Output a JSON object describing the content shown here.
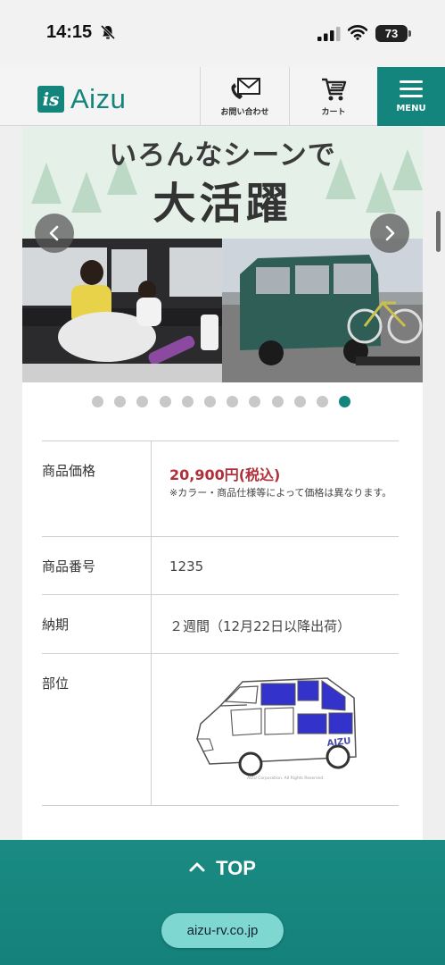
{
  "status_bar": {
    "time": "14:15",
    "battery": "73",
    "icons": [
      "bell-muted-icon",
      "signal-icon",
      "wifi-icon",
      "battery-icon"
    ]
  },
  "header": {
    "logo_mark": "is",
    "logo_text": "Aizu",
    "contact_label": "お問い合わせ",
    "cart_label": "カート",
    "menu_label": "MENU",
    "brand_color": "#14857c"
  },
  "carousel": {
    "banner_line1": "いろんなシーンで",
    "banner_line2": "大活躍",
    "slide_count": 12,
    "active_slide": 12,
    "prev_icon": "chevron-left-icon",
    "next_icon": "chevron-right-icon"
  },
  "spec": {
    "price_label": "商品価格",
    "price": "20,900円(税込)",
    "price_note": "※カラー・商品仕様等によって価格は異なります。",
    "number_label": "商品番号",
    "number": "1235",
    "delivery_label": "納期",
    "delivery": "２週間（12月22日以降出荷）",
    "part_label": "部位",
    "part_image_caption": "AIZU Corporation. All Rights Reserved.",
    "car_brand": "AIZU"
  },
  "footer": {
    "top_label": "TOP",
    "url": "aizu-rv.co.jp"
  },
  "colors": {
    "accent": "#14857c",
    "price": "#b0303a",
    "window_highlight": "#3333cc"
  }
}
